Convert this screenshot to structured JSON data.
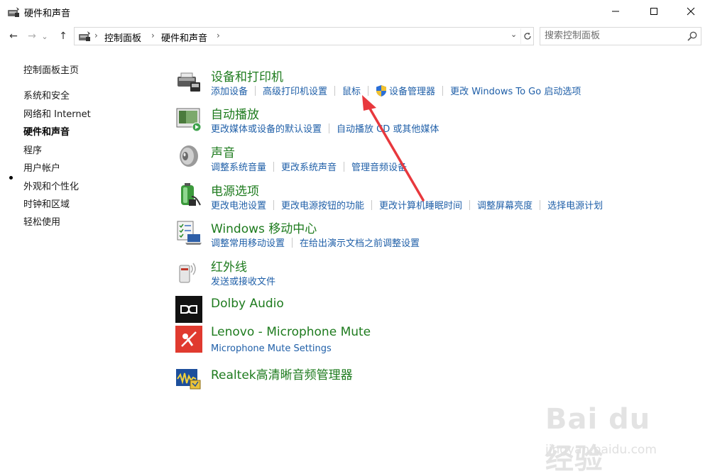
{
  "window": {
    "title": "硬件和声音"
  },
  "nav": {
    "back_glyph": "←",
    "forward_glyph": "→",
    "recent_glyph": "⌄",
    "up_glyph": "↑",
    "breadcrumbs": [
      "控制面板",
      "硬件和声音"
    ],
    "crumb_sep": "›",
    "dropdown_glyph": "⌄"
  },
  "search": {
    "placeholder": "搜索控制面板"
  },
  "sidebar": {
    "items": [
      {
        "label": "控制面板主页"
      },
      {
        "label": "系统和安全"
      },
      {
        "label": "网络和 Internet"
      },
      {
        "label": "硬件和声音",
        "active": true
      },
      {
        "label": "程序"
      },
      {
        "label": "用户帐户"
      },
      {
        "label": "外观和个性化"
      },
      {
        "label": "时钟和区域"
      },
      {
        "label": "轻松使用"
      }
    ]
  },
  "categories": [
    {
      "title": "设备和打印机",
      "icon": "printer-icon",
      "links": [
        "添加设备",
        "高级打印机设置",
        "鼠标",
        "设备管理器",
        "更改 Windows To Go 启动选项"
      ]
    },
    {
      "title": "自动播放",
      "icon": "autoplay-icon",
      "links": [
        "更改媒体或设备的默认设置",
        "自动播放 CD 或其他媒体"
      ]
    },
    {
      "title": "声音",
      "icon": "speaker-icon",
      "links": [
        "调整系统音量",
        "更改系统声音",
        "管理音频设备"
      ]
    },
    {
      "title": "电源选项",
      "icon": "battery-icon",
      "links": [
        "更改电池设置",
        "更改电源按钮的功能",
        "更改计算机睡眠时间",
        "调整屏幕亮度",
        "选择电源计划"
      ]
    },
    {
      "title": "Windows 移动中心",
      "icon": "mobility-center-icon",
      "links": [
        "调整常用移动设置",
        "在给出演示文档之前调整设置"
      ]
    },
    {
      "title": "红外线",
      "icon": "infrared-icon",
      "links": [
        "发送或接收文件"
      ]
    },
    {
      "title": "Dolby Audio",
      "icon": "dolby-icon",
      "links": []
    },
    {
      "title": "Lenovo - Microphone Mute",
      "icon": "microphone-mute-icon",
      "links": [
        "Microphone Mute Settings"
      ]
    },
    {
      "title": "Realtek高清晰音频管理器",
      "icon": "realtek-audio-icon",
      "links": []
    }
  ],
  "watermark": {
    "logo": "Bai du 经验",
    "url": "jingyan.baidu.com"
  },
  "colors": {
    "category_title": "#1e7b1e",
    "link": "#1f5fa8",
    "annotation_arrow": "#e8383d"
  }
}
